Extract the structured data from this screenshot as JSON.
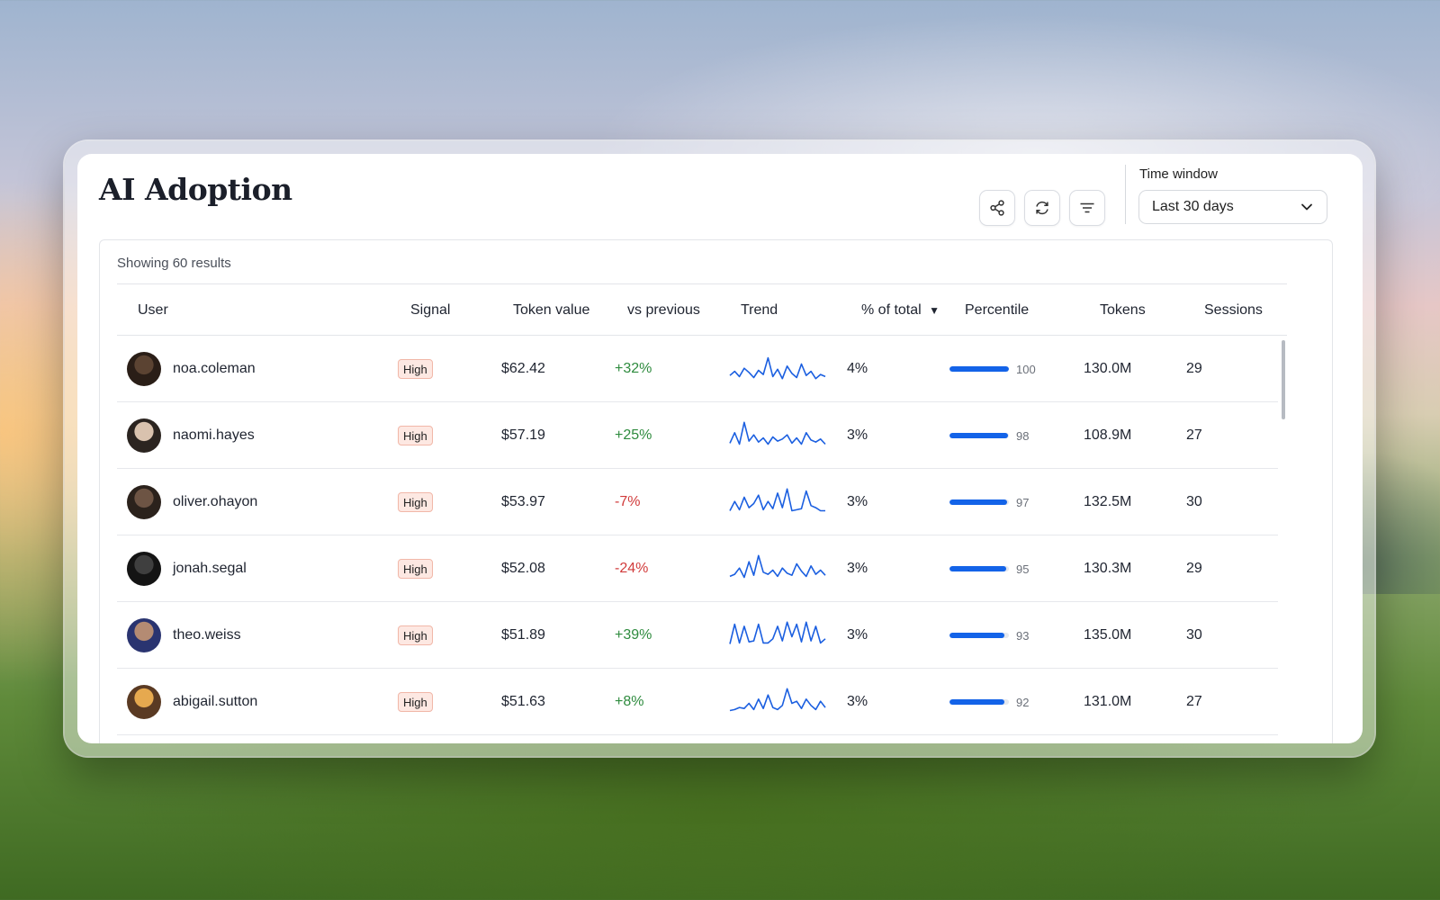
{
  "app": {
    "title": "AI Adoption"
  },
  "toolbar": {
    "time_window_label": "Time window",
    "time_window_value": "Last 30 days",
    "icons": [
      "share-icon",
      "refresh-icon",
      "filter-icon",
      "chevron-down-icon"
    ]
  },
  "table": {
    "results_text": "Showing 60 results",
    "headers": {
      "user": "User",
      "signal": "Signal",
      "token_value": "Token value",
      "vs_previous": "vs previous",
      "trend": "Trend",
      "pct_total": "% of total",
      "percentile": "Percentile",
      "tokens": "Tokens",
      "sessions": "Sessions"
    },
    "sort": {
      "column": "% of total",
      "direction": "descending",
      "indicator": "▼"
    },
    "rows": [
      {
        "user": "noa.coleman",
        "signal": "High",
        "token_value": "$62.42",
        "vs_previous": "+32%",
        "trend_dir": "pos",
        "pct_total": "4%",
        "percentile": "100",
        "percentile_value": 100,
        "tokens": "130.0M",
        "sessions": "29",
        "trend": [
          5,
          9,
          4,
          12,
          8,
          3,
          10,
          6,
          22,
          4,
          11,
          2,
          14,
          7,
          3,
          16,
          5,
          9,
          2,
          6,
          4
        ]
      },
      {
        "user": "naomi.hayes",
        "signal": "High",
        "token_value": "$57.19",
        "vs_previous": "+25%",
        "trend_dir": "pos",
        "pct_total": "3%",
        "percentile": "98",
        "percentile_value": 98,
        "tokens": "108.9M",
        "sessions": "27",
        "trend": [
          4,
          14,
          3,
          24,
          6,
          12,
          5,
          9,
          3,
          10,
          6,
          8,
          12,
          4,
          9,
          3,
          14,
          7,
          5,
          8,
          3
        ]
      },
      {
        "user": "oliver.ohayon",
        "signal": "High",
        "token_value": "$53.97",
        "vs_previous": "-7%",
        "trend_dir": "neg",
        "pct_total": "3%",
        "percentile": "97",
        "percentile_value": 97,
        "tokens": "132.5M",
        "sessions": "30",
        "trend": [
          3,
          12,
          4,
          16,
          6,
          10,
          18,
          4,
          12,
          5,
          20,
          6,
          24,
          3,
          4,
          5,
          22,
          8,
          6,
          3,
          3
        ]
      },
      {
        "user": "jonah.segal",
        "signal": "High",
        "token_value": "$52.08",
        "vs_previous": "-24%",
        "trend_dir": "neg",
        "pct_total": "3%",
        "percentile": "95",
        "percentile_value": 95,
        "tokens": "130.3M",
        "sessions": "29",
        "trend": [
          4,
          6,
          12,
          3,
          18,
          5,
          24,
          8,
          6,
          10,
          4,
          12,
          7,
          5,
          16,
          9,
          4,
          14,
          6,
          10,
          5
        ]
      },
      {
        "user": "theo.weiss",
        "signal": "High",
        "token_value": "$51.89",
        "vs_previous": "+39%",
        "trend_dir": "pos",
        "pct_total": "3%",
        "percentile": "93",
        "percentile_value": 93,
        "tokens": "135.0M",
        "sessions": "30",
        "trend": [
          3,
          22,
          4,
          20,
          5,
          6,
          22,
          4,
          4,
          8,
          20,
          6,
          24,
          10,
          22,
          5,
          24,
          6,
          20,
          4,
          8
        ]
      },
      {
        "user": "abigail.sutton",
        "signal": "High",
        "token_value": "$51.63",
        "vs_previous": "+8%",
        "trend_dir": "pos",
        "pct_total": "3%",
        "percentile": "92",
        "percentile_value": 92,
        "tokens": "131.0M",
        "sessions": "27",
        "trend": [
          3,
          4,
          6,
          5,
          10,
          4,
          14,
          5,
          18,
          6,
          4,
          8,
          24,
          10,
          12,
          5,
          14,
          8,
          4,
          12,
          6
        ]
      }
    ]
  },
  "colors": {
    "accent": "#1363e8",
    "positive": "#2e8b3e",
    "negative": "#d13b3b",
    "badge_bg": "#fde8e2",
    "badge_border": "#f1b7a8"
  }
}
